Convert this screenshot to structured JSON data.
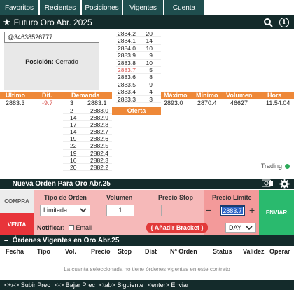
{
  "nav": {
    "tabs": [
      "Favoritos",
      "Recientes",
      "Posiciones",
      "Vigentes",
      "Cuenta"
    ]
  },
  "title": "Futuro Oro Abr. 2025",
  "card": {
    "phone": "@34638526777",
    "position_label": "Posición:",
    "position_value": "Cerrado"
  },
  "ladder": [
    {
      "p": "2884.2",
      "q": "20"
    },
    {
      "p": "2884.1",
      "q": "14"
    },
    {
      "p": "2884.0",
      "q": "10"
    },
    {
      "p": "2883.9",
      "q": "9"
    },
    {
      "p": "2883.8",
      "q": "10"
    },
    {
      "p": "2883.7",
      "q": "5",
      "red": true
    },
    {
      "p": "2883.6",
      "q": "8"
    },
    {
      "p": "2883.5",
      "q": "9"
    },
    {
      "p": "2883.4",
      "q": "4"
    },
    {
      "p": "2883.3",
      "q": "3"
    }
  ],
  "headers": {
    "ultimo": "Último",
    "dif": "Dif.",
    "demanda": "Demanda",
    "maximo": "Máximo",
    "minimo": "Mínimo",
    "volumen": "Volumen",
    "hora": "Hora",
    "oferta": "Oferta"
  },
  "values": {
    "ultimo": "2883.3",
    "dif": "-9.7",
    "demanda_q": "3",
    "demanda_p": "2883.1",
    "maximo": "2893.0",
    "minimo": "2870.4",
    "volumen": "46627",
    "hora": "11:54:04"
  },
  "demanda": [
    {
      "q": "2",
      "p": "2883.0"
    },
    {
      "q": "14",
      "p": "2882.9"
    },
    {
      "q": "17",
      "p": "2882.8"
    },
    {
      "q": "14",
      "p": "2882.7"
    },
    {
      "q": "19",
      "p": "2882.6"
    },
    {
      "q": "22",
      "p": "2882.5"
    },
    {
      "q": "19",
      "p": "2882.4"
    },
    {
      "q": "16",
      "p": "2882.3"
    },
    {
      "q": "20",
      "p": "2882.2"
    }
  ],
  "trading": "Trading",
  "order": {
    "header": "Nueva Orden Para Oro Abr.25",
    "compra": "COMPRA",
    "venta": "VENTA",
    "tipo_label": "Tipo de Orden",
    "tipo_value": "Limitada",
    "volumen_label": "Volumen",
    "volumen_value": "1",
    "stop_label": "Precio Stop",
    "limite_label": "Precio Limite",
    "limite_value": "2883.7",
    "notificar": "Notificar:",
    "email": "Email",
    "bracket": "{ Añadir Bracket }",
    "tif": "DAY",
    "enviar": "ENVIAR"
  },
  "open_orders": {
    "header": "Órdenes Vigentes en Oro Abr.25",
    "columns": [
      "Fecha",
      "Tipo",
      "Vol.",
      "Precio",
      "Stop",
      "Dist",
      "Nº Orden",
      "Status",
      "Validez",
      "Operar"
    ],
    "empty": "La cuenta seleccionada no tiene órdenes vigentes en este contrato"
  },
  "footer": [
    "<+/-> Subir Prec",
    "<-> Bajar Prec",
    "<tab> Siguiente",
    "<enter> Enviar"
  ]
}
